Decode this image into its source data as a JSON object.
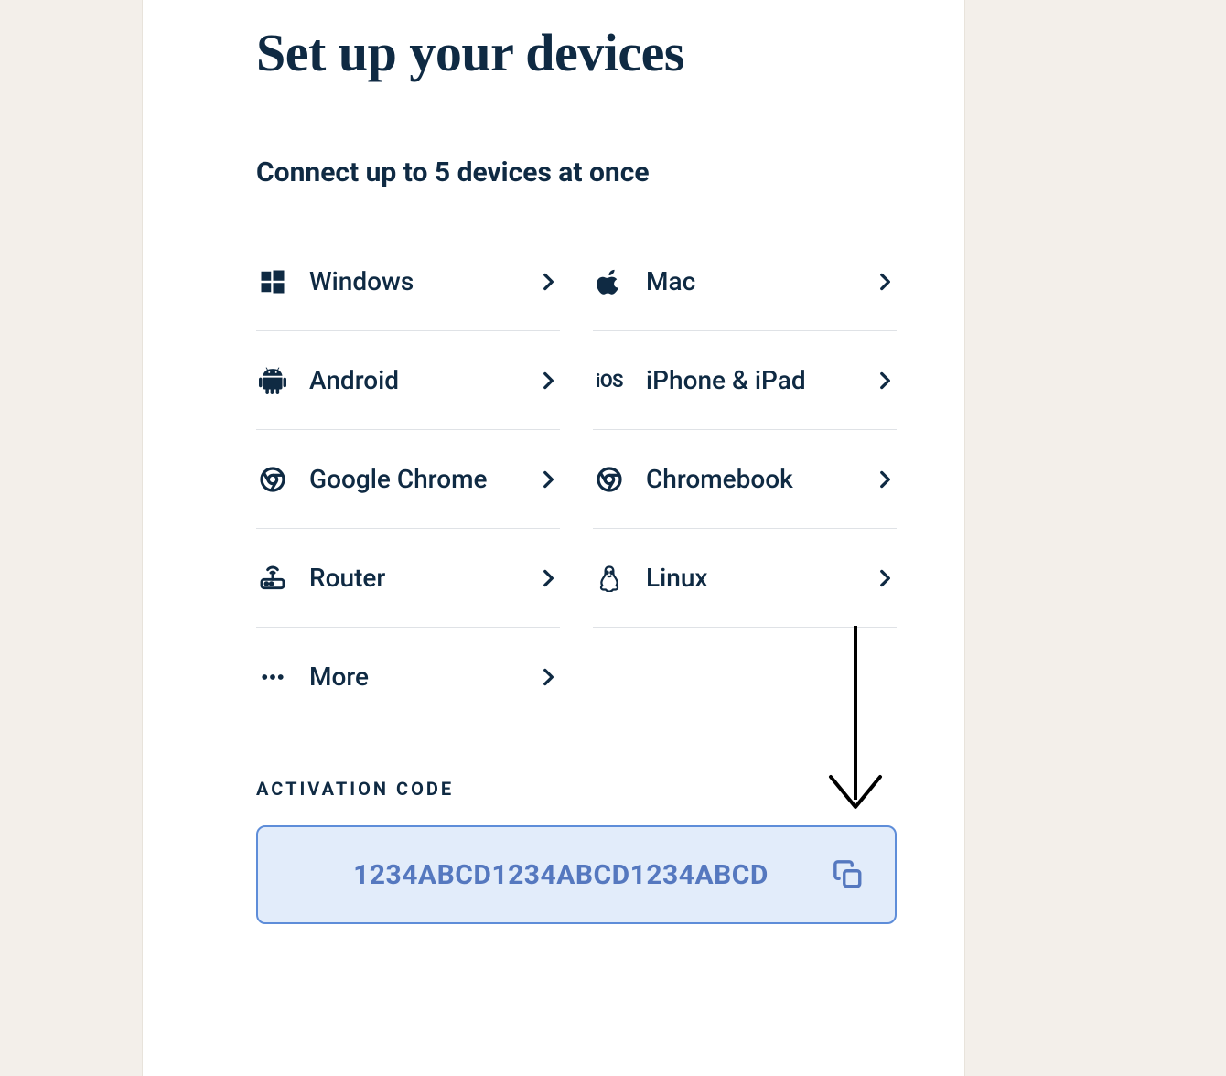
{
  "title": "Set up your devices",
  "subtitle": "Connect up to 5 devices at once",
  "devices": {
    "windows": {
      "label": "Windows"
    },
    "mac": {
      "label": "Mac"
    },
    "android": {
      "label": "Android"
    },
    "ios": {
      "label": "iPhone & iPad"
    },
    "chrome": {
      "label": "Google Chrome"
    },
    "chromebook": {
      "label": "Chromebook"
    },
    "router": {
      "label": "Router"
    },
    "linux": {
      "label": "Linux"
    },
    "more": {
      "label": "More"
    }
  },
  "activation": {
    "label": "ACTIVATION CODE",
    "code": "1234ABCD1234ABCD1234ABCD"
  },
  "colors": {
    "text": "#0f2a43",
    "accent_border": "#5e8dd9",
    "accent_bg": "#e2ecfa",
    "accent_text": "#5578bf"
  }
}
